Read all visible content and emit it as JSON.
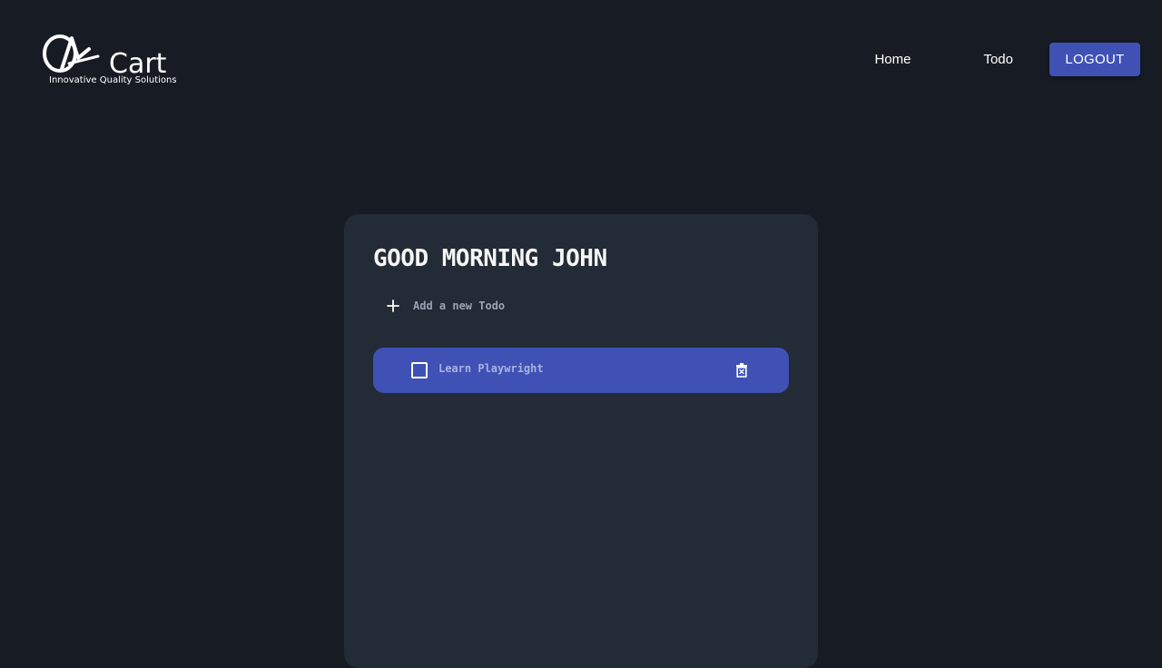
{
  "header": {
    "logo": {
      "brand": "QA Cart",
      "tagline": "Innovative Quality Solutions"
    },
    "nav": {
      "home_label": "Home",
      "todo_label": "Todo",
      "logout_label": "LOGOUT"
    }
  },
  "main": {
    "greeting": "GOOD MORNING JOHN",
    "add_todo": {
      "icon": "plus-icon",
      "placeholder": "Add a new Todo",
      "value": ""
    },
    "todos": [
      {
        "text": "Learn Playwright",
        "completed": false,
        "delete_icon": "trash-icon"
      }
    ]
  },
  "colors": {
    "background": "#171c24",
    "card": "#222b36",
    "accent": "#3f51b5",
    "muted_text": "#9aa4b2"
  }
}
